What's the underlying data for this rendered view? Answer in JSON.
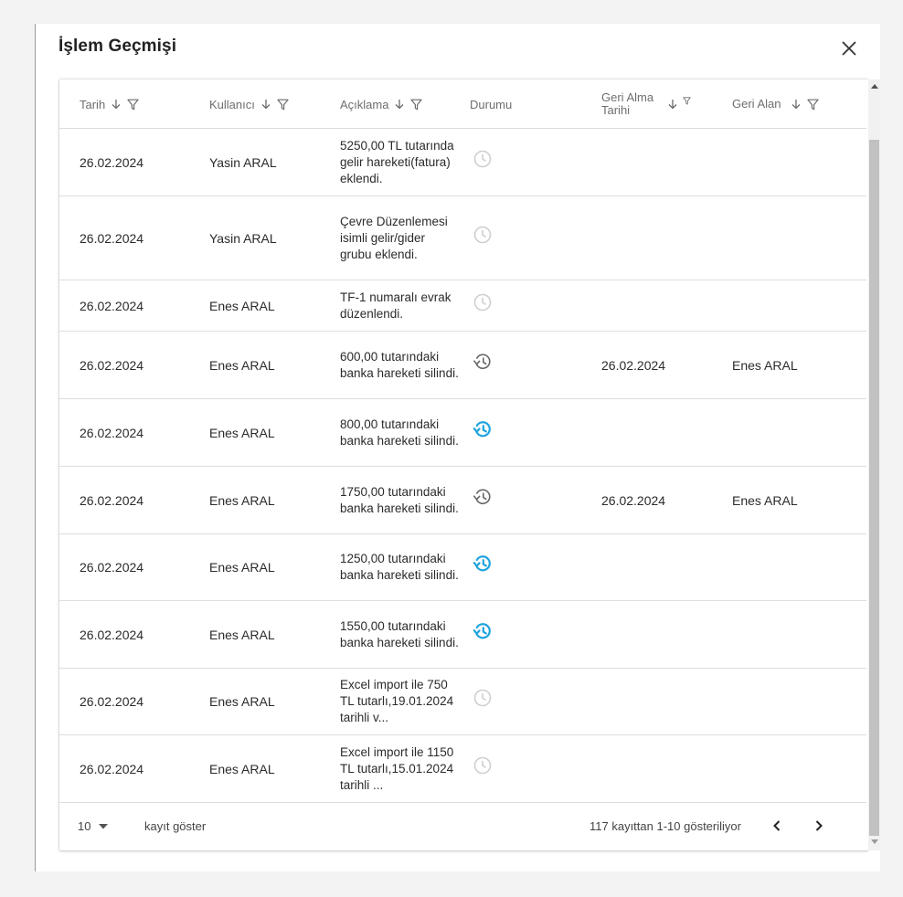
{
  "modal": {
    "title": "İşlem Geçmişi",
    "close_icon": "close-icon"
  },
  "colors": {
    "restore_active": "#1fa3dc",
    "restore_done": "#666666",
    "pending": "#cfcfcf"
  },
  "columns": [
    {
      "key": "date",
      "label": "Tarih"
    },
    {
      "key": "user",
      "label": "Kullanıcı"
    },
    {
      "key": "desc",
      "label": "Açıklama"
    },
    {
      "key": "status",
      "label": "Durumu"
    },
    {
      "key": "restore_date",
      "label": "Geri Alma Tarihi"
    },
    {
      "key": "restored_by",
      "label": "Geri Alan"
    }
  ],
  "rows": [
    {
      "date": "26.02.2024",
      "user": "Yasin ARAL",
      "desc": "5250,00 TL tutarında gelir hareketi(fatura) eklendi.",
      "status": "pending",
      "restore_date": "",
      "restored_by": ""
    },
    {
      "date": "26.02.2024",
      "user": "Yasin ARAL",
      "desc": "Çevre Düzenlemesi isimli gelir/gider grubu eklendi.",
      "status": "pending",
      "restore_date": "",
      "restored_by": ""
    },
    {
      "date": "26.02.2024",
      "user": "Enes ARAL",
      "desc": "TF-1 numaralı evrak düzenlendi.",
      "status": "pending",
      "restore_date": "",
      "restored_by": ""
    },
    {
      "date": "26.02.2024",
      "user": "Enes ARAL",
      "desc": "600,00 tutarındaki banka hareketi silindi.",
      "status": "restored",
      "restore_date": "26.02.2024",
      "restored_by": "Enes ARAL"
    },
    {
      "date": "26.02.2024",
      "user": "Enes ARAL",
      "desc": "800,00 tutarındaki banka hareketi silindi.",
      "status": "restorable",
      "restore_date": "",
      "restored_by": ""
    },
    {
      "date": "26.02.2024",
      "user": "Enes ARAL",
      "desc": "1750,00 tutarındaki banka hareketi silindi.",
      "status": "restored",
      "restore_date": "26.02.2024",
      "restored_by": "Enes ARAL"
    },
    {
      "date": "26.02.2024",
      "user": "Enes ARAL",
      "desc": "1250,00 tutarındaki banka hareketi silindi.",
      "status": "restorable",
      "restore_date": "",
      "restored_by": ""
    },
    {
      "date": "26.02.2024",
      "user": "Enes ARAL",
      "desc": "1550,00 tutarındaki banka hareketi silindi.",
      "status": "restorable",
      "restore_date": "",
      "restored_by": ""
    },
    {
      "date": "26.02.2024",
      "user": "Enes ARAL",
      "desc": "Excel import ile 750 TL tutarlı,19.01.2024 tarihli v...",
      "status": "pending",
      "restore_date": "",
      "restored_by": ""
    },
    {
      "date": "26.02.2024",
      "user": "Enes ARAL",
      "desc": "Excel import ile 1150 TL tutarlı,15.01.2024 tarihli ...",
      "status": "pending",
      "restore_date": "",
      "restored_by": ""
    }
  ],
  "pagination": {
    "page_size": "10",
    "page_size_label": "kayıt göster",
    "info": "117 kayıttan 1-10 gösteriliyor"
  }
}
